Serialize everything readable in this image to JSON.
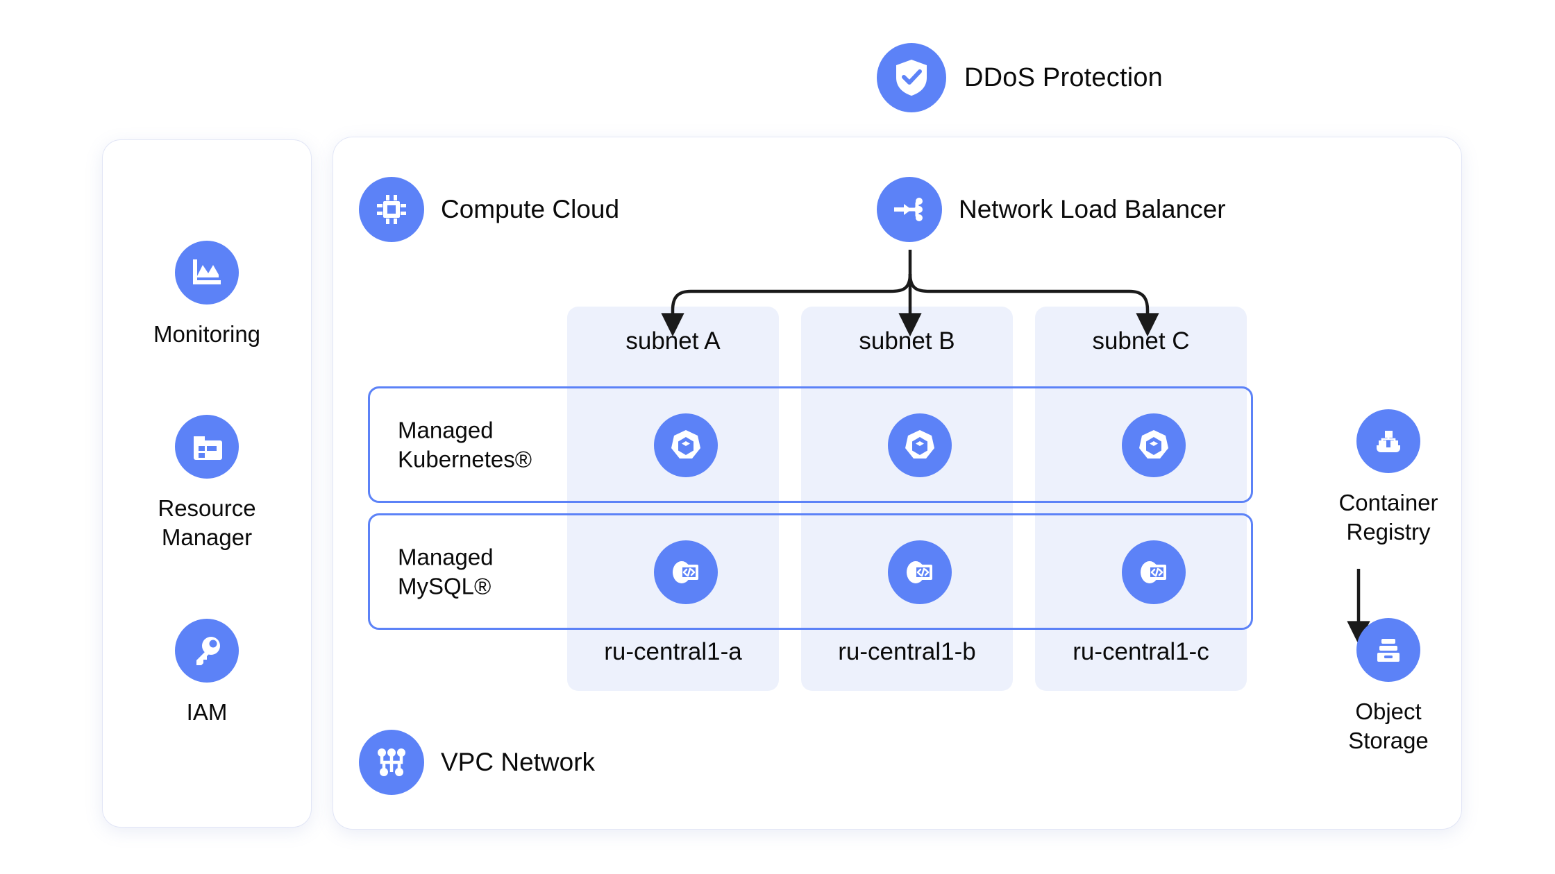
{
  "theme": {
    "accent": "#5C82F7",
    "zone_bg": "#EDF1FC",
    "page_bg": "#FFFFFF",
    "text": "#0A0A0A"
  },
  "header": {
    "ddos": {
      "label": "DDoS Protection",
      "icon": "shield-check-icon"
    }
  },
  "sidebar": {
    "items": [
      {
        "label": "Monitoring",
        "icon": "chart-icon"
      },
      {
        "label": "Resource\nManager",
        "icon": "folder-panel-icon"
      },
      {
        "label": "IAM",
        "icon": "key-icon"
      }
    ]
  },
  "vpc_panel": {
    "compute": {
      "label": "Compute Cloud",
      "icon": "cpu-chip-icon"
    },
    "load_balancer": {
      "label": "Network Load Balancer",
      "icon": "load-balancer-icon"
    },
    "network": {
      "label": "VPC Network",
      "icon": "network-topology-icon"
    },
    "zones": [
      {
        "subnet": "subnet A",
        "zone": "ru-central1-a"
      },
      {
        "subnet": "subnet B",
        "zone": "ru-central1-b"
      },
      {
        "subnet": "subnet C",
        "zone": "ru-central1-c"
      }
    ],
    "bands": [
      {
        "label": "Managed\nKubernetes®",
        "icon": "kubernetes-icon"
      },
      {
        "label": "Managed\nMySQL®",
        "icon": "mysql-database-icon"
      }
    ]
  },
  "right_column": {
    "items": [
      {
        "label": "Container\nRegistry",
        "icon": "container-registry-icon"
      },
      {
        "label": "Object\nStorage",
        "icon": "object-storage-icon"
      }
    ]
  }
}
